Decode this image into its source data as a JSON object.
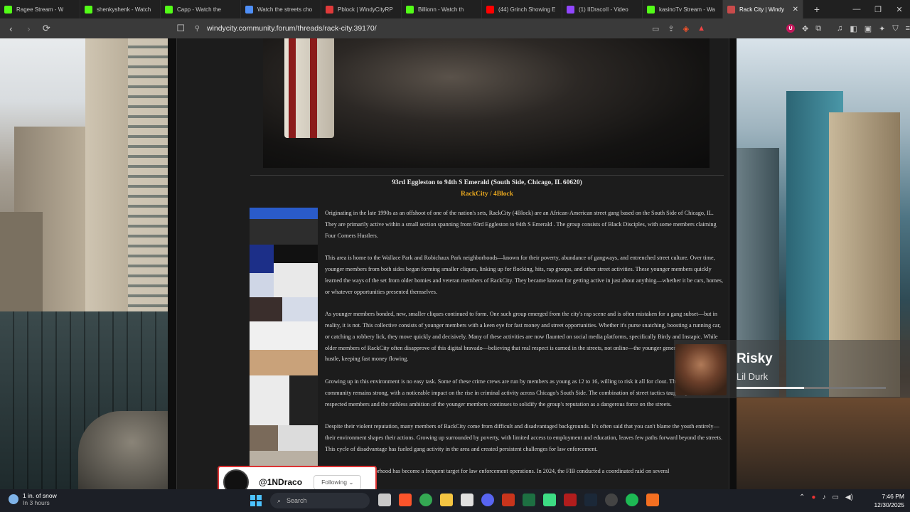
{
  "browser": {
    "tabs": [
      {
        "label": "Ragee Stream - W",
        "icon_color": "#53fc18"
      },
      {
        "label": "shenkyshenk - Watch",
        "icon_color": "#53fc18"
      },
      {
        "label": "Capp - Watch the",
        "icon_color": "#53fc18"
      },
      {
        "label": "Watch the streets cho",
        "icon_color": "#4f8ff7"
      },
      {
        "label": "Pblock | WindyCityRP",
        "icon_color": "#e03a3a"
      },
      {
        "label": "Billionn - Watch th",
        "icon_color": "#53fc18"
      },
      {
        "label": "(44) Grinch Showing E",
        "icon_color": "#ff0000"
      },
      {
        "label": "(1) IIDracoII - Video",
        "icon_color": "#9146ff"
      },
      {
        "label": "kasinoTv Stream - Wa",
        "icon_color": "#53fc18"
      },
      {
        "label": "Rack City | Windy",
        "icon_color": "#c94b4b",
        "active": true
      }
    ],
    "new_tab": "+",
    "window_controls": [
      "—",
      "❐",
      "✕"
    ],
    "url": "windycity.community.forum/threads/rack-city.39170/",
    "nav": {
      "back": "‹",
      "forward": "›",
      "reload": "⟳",
      "bookmark": "☐"
    }
  },
  "post": {
    "location": "93rd Eggleston to 94th S Emerald (South Side, Chicago, IL 60620)",
    "gang_name": "RackCity / 4Block",
    "paragraphs": [
      "Originating in the late 1990s as an offshoot of one of the nation's sets, RackCity (4Block) are an African-American street gang based on the South Side of Chicago, IL. They are primarily active within a small section spanning from 93rd Eggleston to 94th S Emerald . The group consists of Black Disciples, with some members claiming Four Corners Hustlers.",
      "This area is home to the Wallace Park and Robichaux Park neighborhoods—known for their poverty, abundance of gangways, and entrenched street culture. Over time, younger members from both sides began forming smaller cliques, linking up for flocking, hits, rap groups, and other street activities. These younger members quickly learned the ways of the set from older homies and veteran members of RackCity. They became known for getting active in just about anything—whether it be cars, homes, or whatever opportunities presented themselves.",
      "As younger members bonded, new, smaller cliques continued to form. One such group emerged from the city's rap scene and is often mistaken for a gang subset—but in reality, it is not. This collective consists of younger members with a keen eye for fast money and street opportunities. Whether it's purse snatching, boosting a running car, or catching a robbery lick, they move quickly and decisively. Many of these activities are now flaunted on social media platforms, specifically Birdy and Instapic. While older members of RackCity often disapprove of this digital bravado—believing that real respect is earned in the streets, not online—the younger generation continues their hustle, keeping fast money flowing.",
      "Growing up in this environment is no easy task. Some of these crime crews are run by members as young as 12 to 16, willing to risk it all for clout. Their presence in the community remains strong, with a noticeable impact on the rise in criminal activity across Chicago's South Side. The combination of street tactics taught by older, respected members and the ruthless ambition of the younger members continues to solidify the group's reputation as a dangerous force on the streets.",
      "Despite their violent reputation, many members of RackCity come from difficult and disadvantaged backgrounds. It's often said that you can't blame the youth entirely—their environment shapes their actions. Growing up surrounded by poverty, with limited access to employment and education, leaves few paths forward beyond the streets. This cycle of disadvantage has fueled gang activity in the area and created persistent challenges for law enforcement.",
      "The RackCity neighborhood has become a frequent target for law enforcement operations. In 2024, the FIB conducted a coordinated raid on several"
    ]
  },
  "now_playing": {
    "title": "Risky",
    "artist": "Lil Durk",
    "progress": 0.45
  },
  "follow_card": {
    "handle": "@1NDraco",
    "button": "Following ⌄"
  },
  "taskbar": {
    "weather_line1": "1 in. of snow",
    "weather_line2": "In 3 hours",
    "search_placeholder": "Search",
    "time": "7:46 PM",
    "date": "12/30/2025"
  }
}
